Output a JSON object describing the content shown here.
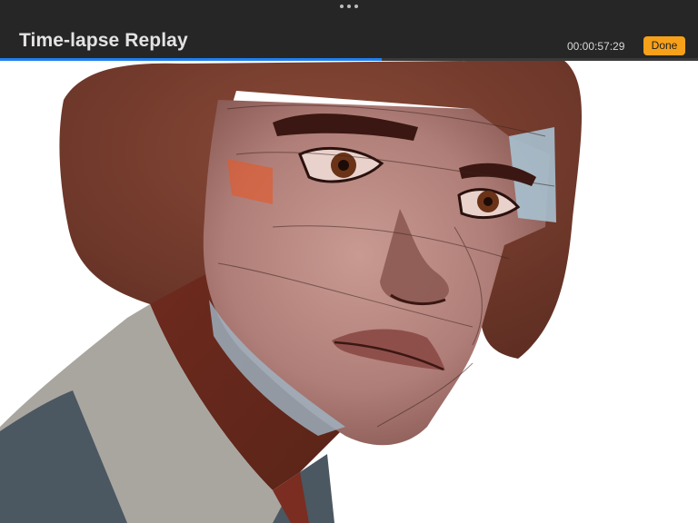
{
  "header": {
    "title": "Time-lapse Replay",
    "elapsed_time": "00:00:57:29",
    "done_label": "Done"
  },
  "playback": {
    "progress_fraction": 0.547
  },
  "colors": {
    "header_bg": "#262626",
    "accent": "#f7a01a",
    "progress": "#1f7ff0"
  },
  "icons": {
    "handle": "more-dots-icon"
  }
}
